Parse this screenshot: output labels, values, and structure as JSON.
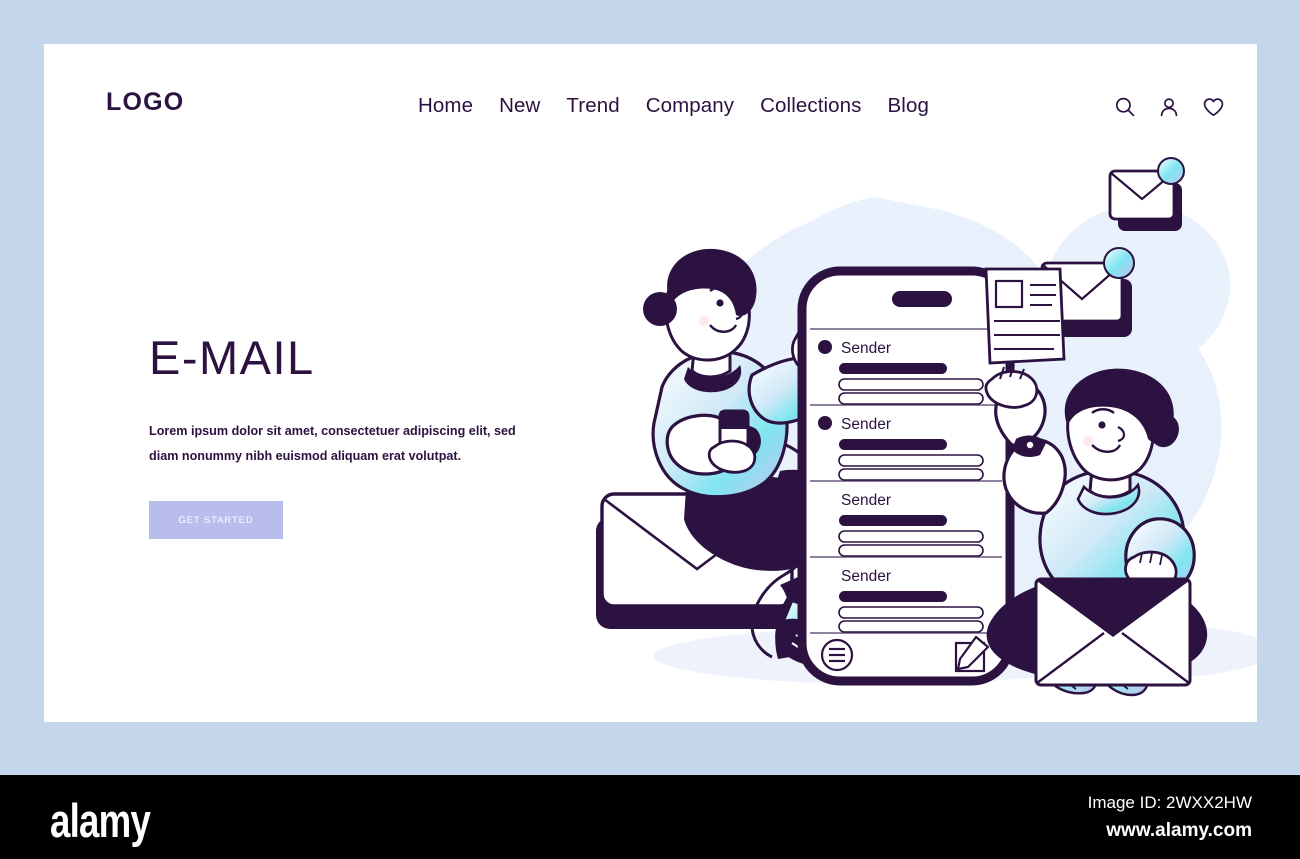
{
  "window": {
    "outer_background": "#c3d6ea",
    "card_background": "#ffffff"
  },
  "header": {
    "logo": "LOGO",
    "nav": [
      {
        "label": "Home",
        "name": "nav-link-home"
      },
      {
        "label": "New",
        "name": "nav-link-new"
      },
      {
        "label": "Trend",
        "name": "nav-link-trend"
      },
      {
        "label": "Company",
        "name": "nav-link-company"
      },
      {
        "label": "Collections",
        "name": "nav-link-collections"
      },
      {
        "label": "Blog",
        "name": "nav-link-blog"
      }
    ],
    "icons": [
      "search-icon",
      "user-icon",
      "heart-icon"
    ]
  },
  "hero": {
    "title": "E-MAIL",
    "paragraph": "Lorem ipsum dolor sit amet, consectetuer adipiscing elit, sed diam nonummy nibh euismod aliquam erat volutpat.",
    "cta_label": "GET STARTED",
    "cta_color": "#b9bdec",
    "text_color": "#2b1240"
  },
  "illustration": {
    "theme": "email-landing-illustration",
    "phone": {
      "inbox_items": [
        {
          "sender": "Sender",
          "unread": true
        },
        {
          "sender": "Sender",
          "unread": true
        },
        {
          "sender": "Sender",
          "unread": false
        },
        {
          "sender": "Sender",
          "unread": false
        }
      ],
      "bottom_bar": [
        "menu-icon",
        "compose-icon"
      ]
    },
    "floating_envelopes": 2,
    "characters": [
      "woman-sitting-on-envelope",
      "man-holding-envelope"
    ],
    "colors": {
      "ink": "#2b1240",
      "blob": "#e6eefb",
      "accent_cyan": "#7fe5f0",
      "accent_lavender": "#b9bdec"
    }
  },
  "watermark": {
    "brand": "alamy",
    "image_id": "Image ID: 2WXX2HW",
    "url": "www.alamy.com"
  }
}
